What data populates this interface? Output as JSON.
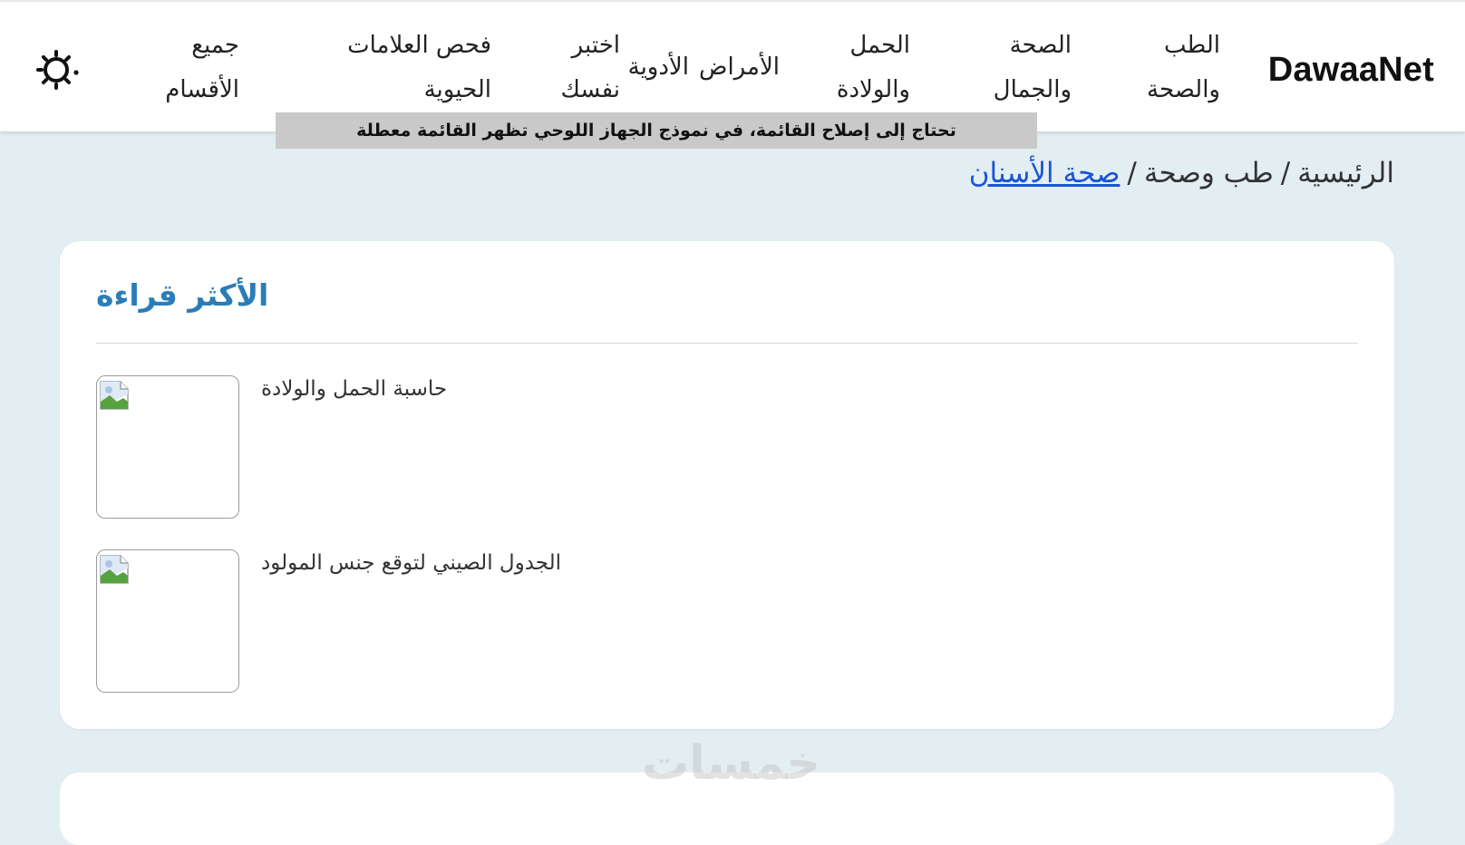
{
  "header": {
    "brand": "DawaaNet",
    "nav": [
      {
        "label": "الطب\nوالصحة"
      },
      {
        "label": "الصحة\nوالجمال"
      },
      {
        "label": "الحمل\nوالولادة"
      },
      {
        "label": "الأمراض"
      },
      {
        "label": "الأدوية"
      },
      {
        "label": "اختبر\nنفسك"
      },
      {
        "label": "فحص العلامات\nالحيوية"
      },
      {
        "label": "جميع\nالأقسام"
      }
    ],
    "theme_toggle_icon": "sun-icon"
  },
  "notice": "تحتاج إلى إصلاح القائمة، في نموذج الجهاز اللوحي تظهر القائمة معطلة",
  "breadcrumb": {
    "home": "الرئيسية",
    "section": "طب وصحة",
    "current": "صحة الأسنان",
    "separator": "/"
  },
  "most_read": {
    "title": "الأكثر قراءة",
    "items": [
      {
        "label": "حاسبة الحمل والولادة",
        "image_icon": "broken-image-icon"
      },
      {
        "label": "الجدول الصيني لتوقع جنس المولود",
        "image_icon": "broken-image-icon"
      }
    ]
  },
  "watermark": "خمسات",
  "colors": {
    "page_bg": "#e3eef3",
    "card_title": "#2a7db6",
    "link": "#1a54d8",
    "notice_bg": "#c9c9c9"
  }
}
